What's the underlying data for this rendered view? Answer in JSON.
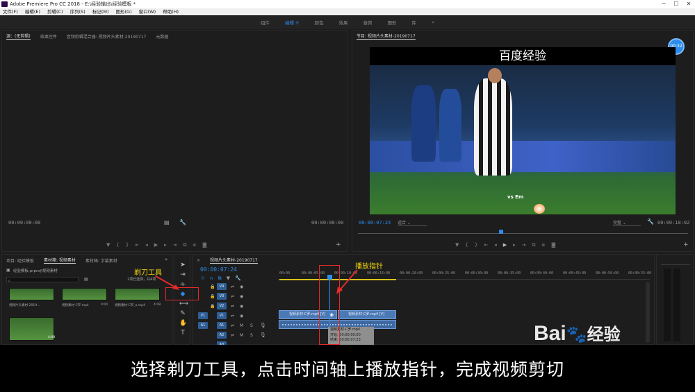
{
  "window": {
    "title": "Adobe Premiere Pro CC 2018 - E:\\经验输出\\经验模板 *",
    "controls": [
      "─",
      "☐",
      "✕"
    ]
  },
  "menubar": [
    "文件(F)",
    "编辑(E)",
    "剪辑(C)",
    "序列(S)",
    "标记(M)",
    "图形(G)",
    "窗口(W)",
    "帮助(H)"
  ],
  "workspaces": {
    "items": [
      "组件",
      "编辑",
      "颜色",
      "效果",
      "音频",
      "图形",
      "库"
    ],
    "active_index": 1,
    "more": "»"
  },
  "source_monitor": {
    "tabs": [
      "源：(无剪辑)",
      "效果控件",
      "音频剪辑混合器: 视频片头素材-20190717",
      "元数据"
    ],
    "timecode_left": "00:00:00:00",
    "timecode_right": "00:00:00:00"
  },
  "program_monitor": {
    "tab": "节目: 视频片头素材-20190717",
    "badge": "00:32",
    "video_caption": "百度经验",
    "watermark": "vs Em",
    "timecode_left": "00:00:07:24",
    "fit": "适合",
    "quality": "完整",
    "timecode_right": "00:00:18:02"
  },
  "project_panel": {
    "tabs": [
      "项目: 经验模板",
      "素材箱: 视频素材",
      "素材箱: 字幕素材"
    ],
    "path": "经验模板.prproj\\视频素材",
    "selection_info": "1项已选择，共4项",
    "items": [
      {
        "name": "视频片头素材-2019...",
        "duration": ""
      },
      {
        "name": "视频素材-C罗.mp4",
        "duration": "0:04"
      },
      {
        "name": "视频素材-C罗_a.mp4",
        "duration": "4:08"
      },
      {
        "name": "",
        "duration": "4:08"
      }
    ]
  },
  "timeline": {
    "tab": "视频片头素材-20190717",
    "timecode": "00:00:07:24",
    "ruler": [
      "00:00",
      "00:00:05:00",
      "00:00:10:00",
      "00:00:15:00",
      "00:00:20:00",
      "00:00:25:00",
      "00:00:30:00",
      "00:00:35:00",
      "00:00:40:00",
      "00:00:45:00",
      "00:00:50:00",
      "00:00:55:00"
    ],
    "video_tracks": [
      "V4",
      "V3",
      "V2",
      "V1"
    ],
    "audio_tracks": [
      "A1",
      "A2",
      "A3"
    ],
    "source_patch_v": "V1",
    "source_patch_a": "A1",
    "clip_left": "视频素材-C罗.mp4 [V]",
    "clip_right": "视频素材-C罗.mp4 [V]",
    "tooltip": {
      "name": "视频素材-C罗.mp4",
      "start": "开始: 00:00:00:00",
      "end": "结束: 00:00:07:23"
    }
  },
  "annotations": {
    "razor_label": "剃刀工具",
    "playhead_label": "播放指针"
  },
  "subtitle": "选择剃刀工具，点击时间轴上播放指针，完成视频剪切",
  "logo": {
    "text": "Bai",
    "paw": "🐾",
    "suffix": "经验"
  },
  "colors": {
    "accent": "#2d8ceb",
    "annotation": "#f5d90a",
    "highlight_box": "#e42a2a",
    "clip": "#4b79b5"
  }
}
